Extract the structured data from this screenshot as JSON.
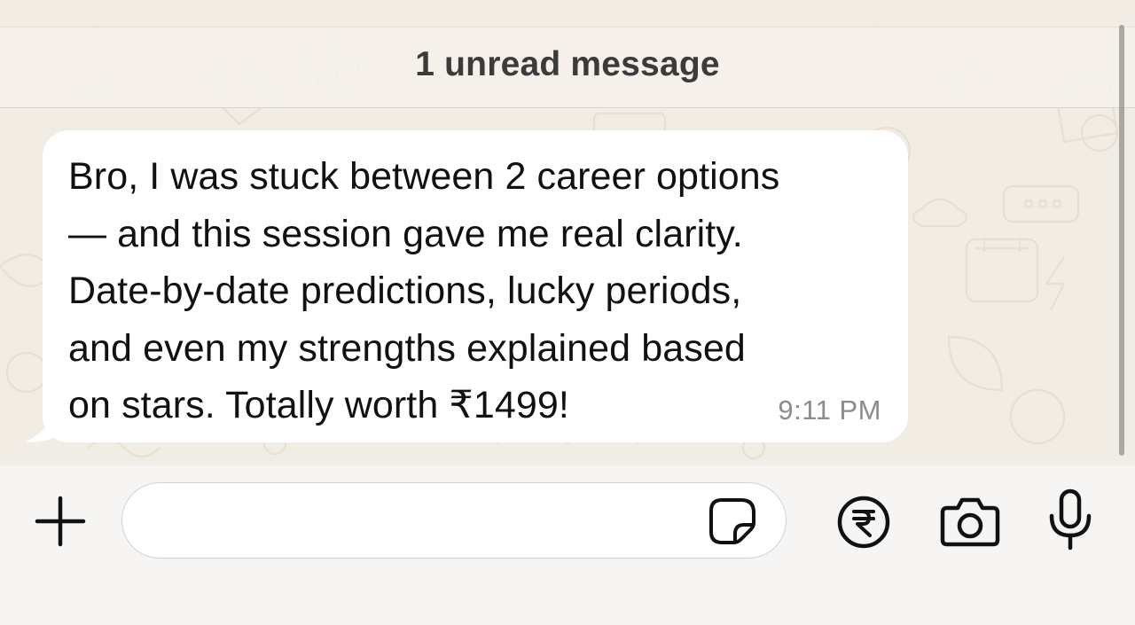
{
  "chat": {
    "unread_banner": "1 unread message",
    "message": {
      "text": "Bro, I was stuck between 2 career options\n— and this session gave me real clarity.\nDate-by-date predictions, lucky periods,\nand even my strengths explained based\non stars. Totally worth ₹1499!",
      "time": "9:11 PM"
    }
  },
  "composer": {
    "message_value": "",
    "message_placeholder": "",
    "icons": {
      "attach": "plus-icon",
      "sticker": "sticker-icon",
      "payment": "rupee-icon",
      "camera": "camera-icon",
      "voice": "microphone-icon"
    }
  },
  "colors": {
    "wallpaper": "#f2ede4",
    "bubble": "#ffffff",
    "text": "#111111",
    "timestamp": "#8c8c8c",
    "input_bar": "#f6f5f3"
  }
}
